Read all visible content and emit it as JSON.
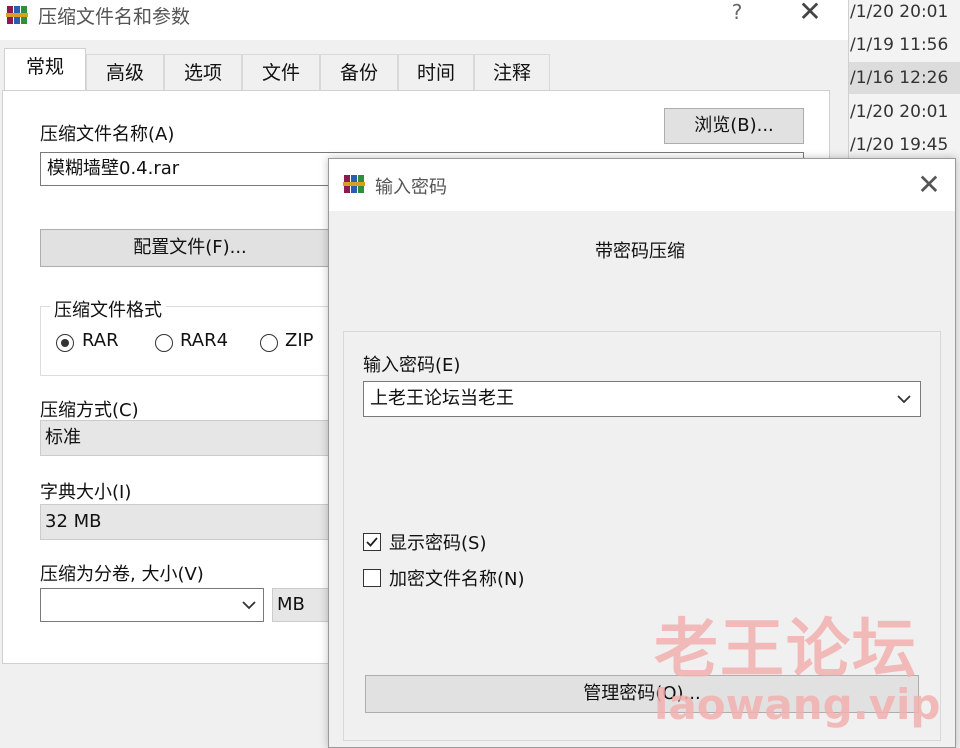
{
  "background_list": {
    "rows": [
      "/1/20 20:01",
      "/1/19 11:56",
      "/1/16 12:26",
      "/1/20 20:01",
      "/1/20 19:45"
    ]
  },
  "main_window": {
    "title": "压缩文件名和参数",
    "help_label": "?",
    "close_label": "✕",
    "tabs": [
      "常规",
      "高级",
      "选项",
      "文件",
      "备份",
      "时间",
      "注释"
    ],
    "archive_name_label": "压缩文件名称(A)",
    "archive_name_value": "模糊墙壁0.4.rar",
    "browse_label": "浏览(B)...",
    "profile_label": "配置文件(F)...",
    "format_group_label": "压缩文件格式",
    "formats": [
      "RAR",
      "RAR4",
      "ZIP"
    ],
    "selected_format": "RAR",
    "method_label": "压缩方式(C)",
    "method_value": "标准",
    "dict_label": "字典大小(I)",
    "dict_value": "32 MB",
    "split_label": "压缩为分卷, 大小(V)",
    "split_value": "",
    "split_unit": "MB"
  },
  "password_dialog": {
    "title": "输入密码",
    "heading": "带密码压缩",
    "password_label": "输入密码(E)",
    "password_value": "上老王论坛当老王",
    "show_password_label": "显示密码(S)",
    "show_password_checked": true,
    "encrypt_names_label": "加密文件名称(N)",
    "encrypt_names_checked": false,
    "manage_label": "管理密码(O)...",
    "close_label": "✕"
  },
  "watermark": {
    "brand": "老王论坛",
    "url": "laowang.vip"
  },
  "colors": {
    "watermark": "#f3b0b0",
    "window_bg": "#f0f0f0",
    "panel_bg": "#ffffff"
  }
}
